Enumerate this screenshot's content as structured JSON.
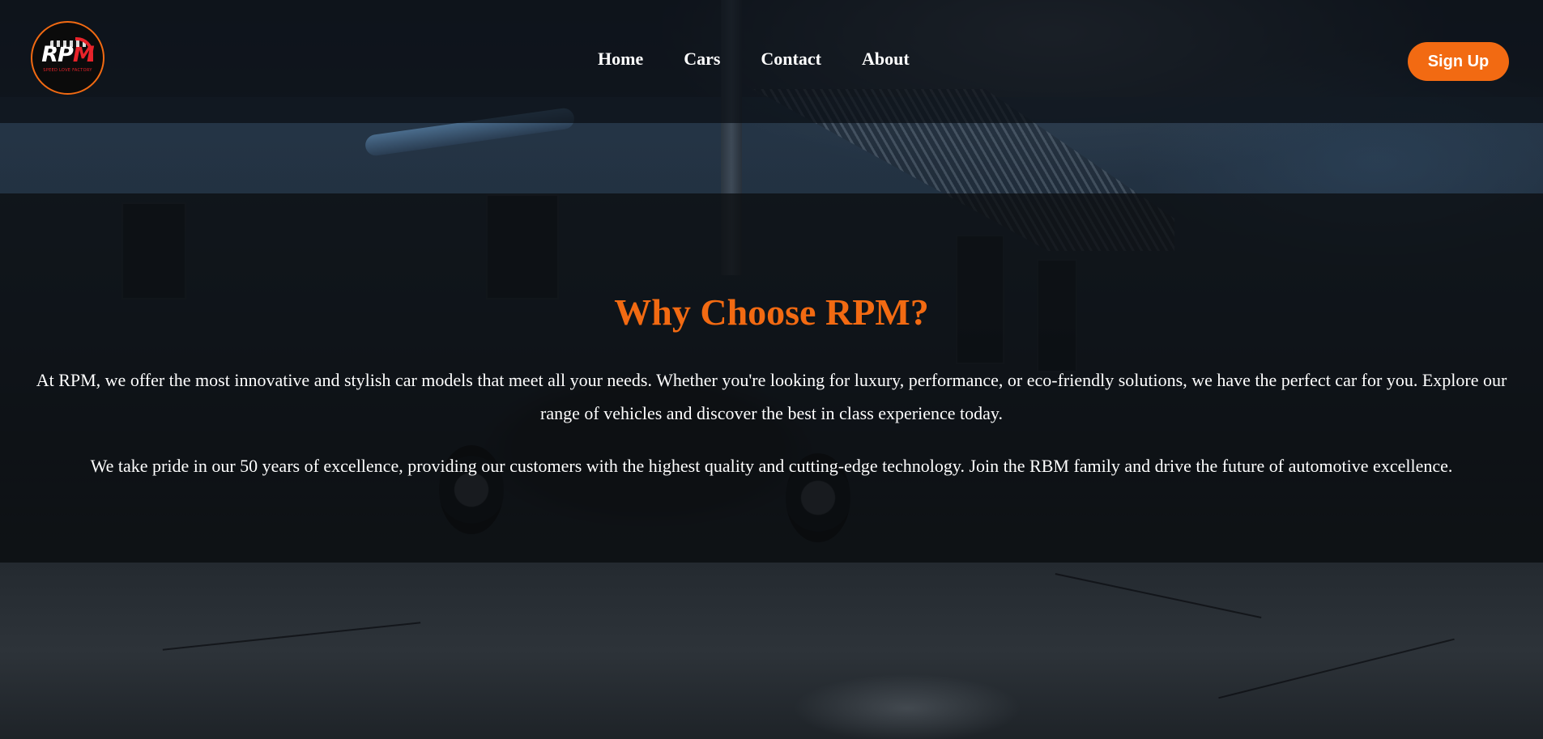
{
  "brand": {
    "logo_text_main": "RP",
    "logo_text_accent": "M",
    "logo_sub": "SPEED LOVE FACTORY",
    "accent_color": "#f26a12"
  },
  "nav": {
    "items": [
      {
        "label": "Home"
      },
      {
        "label": "Cars"
      },
      {
        "label": "Contact"
      },
      {
        "label": "About"
      }
    ],
    "signup_label": "Sign Up"
  },
  "why": {
    "title": "Why Choose RPM?",
    "paragraph1": "At RPM, we offer the most innovative and stylish car models that meet all your needs. Whether you're looking for luxury, performance, or eco-friendly solutions, we have the perfect car for you. Explore our range of vehicles and discover the best in class experience today.",
    "paragraph2": "We take pride in our 50 years of excellence, providing our customers with the highest quality and cutting-edge technology. Join the RBM family and drive the future of automotive excellence."
  }
}
